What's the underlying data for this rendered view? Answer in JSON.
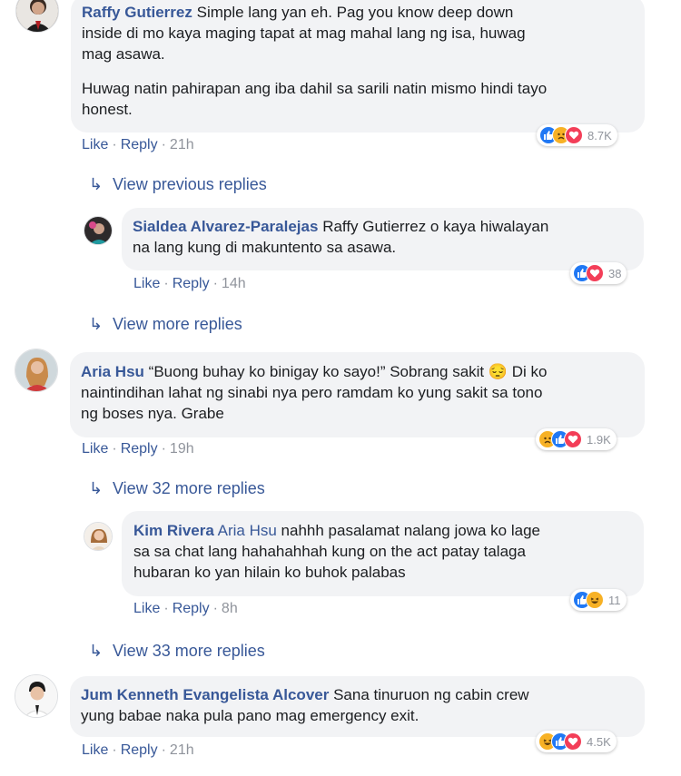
{
  "comments": [
    {
      "author": "Raffy Gutierrez",
      "text_line1": "Simple lang yan eh. Pag you know deep down",
      "text_line2": "inside di mo kaya maging tapat at mag mahal lang ng isa, huwag",
      "text_line3": "mag asawa.",
      "text_p2_line1": "Huwag natin pahirapan ang iba dahil sa sarili natin mismo hindi tayo",
      "text_p2_line2": "honest.",
      "like": "Like",
      "reply": "Reply",
      "time": "21h",
      "reaction_count": "8.7K",
      "reaction_icons": [
        "like-icon",
        "sad-icon",
        "love-icon"
      ]
    },
    {
      "author": "Aria Hsu",
      "text_line1": "“Buong buhay ko binigay ko sayo!” Sobrang sakit 😔  Di ko",
      "text_line2": "naintindihan lahat ng sinabi nya pero ramdam ko yung sakit sa tono",
      "text_line3": "ng boses nya. Grabe",
      "like": "Like",
      "reply": "Reply",
      "time": "19h",
      "reaction_count": "1.9K",
      "reaction_icons": [
        "sad-icon",
        "like-icon",
        "love-icon"
      ]
    },
    {
      "author": "Jum Kenneth Evangelista Alcover",
      "text_line1": "Sana tinuruon ng cabin crew",
      "text_line2": "yung babae naka pula pano mag emergency exit.",
      "like": "Like",
      "reply": "Reply",
      "time": "21h",
      "reaction_count": "4.5K",
      "reaction_icons": [
        "haha-icon",
        "like-icon",
        "love-icon"
      ]
    }
  ],
  "replies": [
    {
      "author": "Sialdea Alvarez-Paralejas",
      "mention": "",
      "text_line1": "Raffy Gutierrez o kaya hiwalayan",
      "text_line2": "na lang kung di makuntento sa asawa.",
      "like": "Like",
      "reply": "Reply",
      "time": "14h",
      "reaction_count": "38",
      "reaction_icons": [
        "like-icon",
        "love-icon"
      ]
    },
    {
      "author": "Kim Rivera",
      "mention": "Aria Hsu",
      "text_line1": "nahhh pasalamat nalang jowa ko lage",
      "text_line2": "sa sa chat lang hahahahhah kung on the act patay talaga",
      "text_line3": "hubaran ko yan hilain ko buhok palabas",
      "like": "Like",
      "reply": "Reply",
      "time": "8h",
      "reaction_count": "11",
      "reaction_icons": [
        "like-icon",
        "haha-icon"
      ]
    }
  ],
  "view_links": {
    "previous": "View previous replies",
    "more": "View more replies",
    "more32": "View 32 more replies",
    "more33": "View 33 more replies"
  },
  "colors": {
    "link": "#385898",
    "bubble": "#f2f3f5",
    "meta": "#90949c",
    "like_blue": "#2078f4",
    "love_red": "#f33e58",
    "emoji_yellow": "#f7b125"
  }
}
